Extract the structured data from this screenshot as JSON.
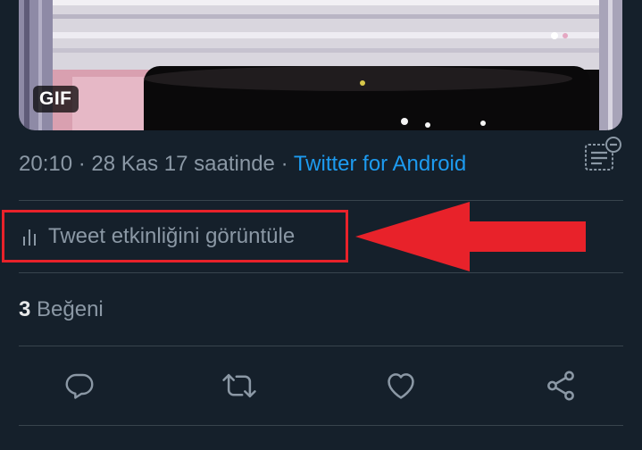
{
  "media": {
    "badge": "GIF"
  },
  "tweet_meta": {
    "time": "20:10",
    "separator_1": "·",
    "date": "28 Kas 17 saatinde",
    "separator_2": "·",
    "source": "Twitter for Android"
  },
  "activity": {
    "label": "Tweet etkinliğini görüntüle",
    "icon": "bar-chart-icon"
  },
  "likes": {
    "count": "3",
    "label": "Beğeni"
  },
  "actions": [
    {
      "name": "reply",
      "icon": "reply-icon"
    },
    {
      "name": "retweet",
      "icon": "retweet-icon"
    },
    {
      "name": "like",
      "icon": "heart-icon"
    },
    {
      "name": "share",
      "icon": "share-icon"
    }
  ],
  "colors": {
    "background": "#15202b",
    "accent": "#1d9bf0",
    "secondary_text": "#8b98a5",
    "highlight": "#e8222a",
    "divider": "#38444d"
  }
}
